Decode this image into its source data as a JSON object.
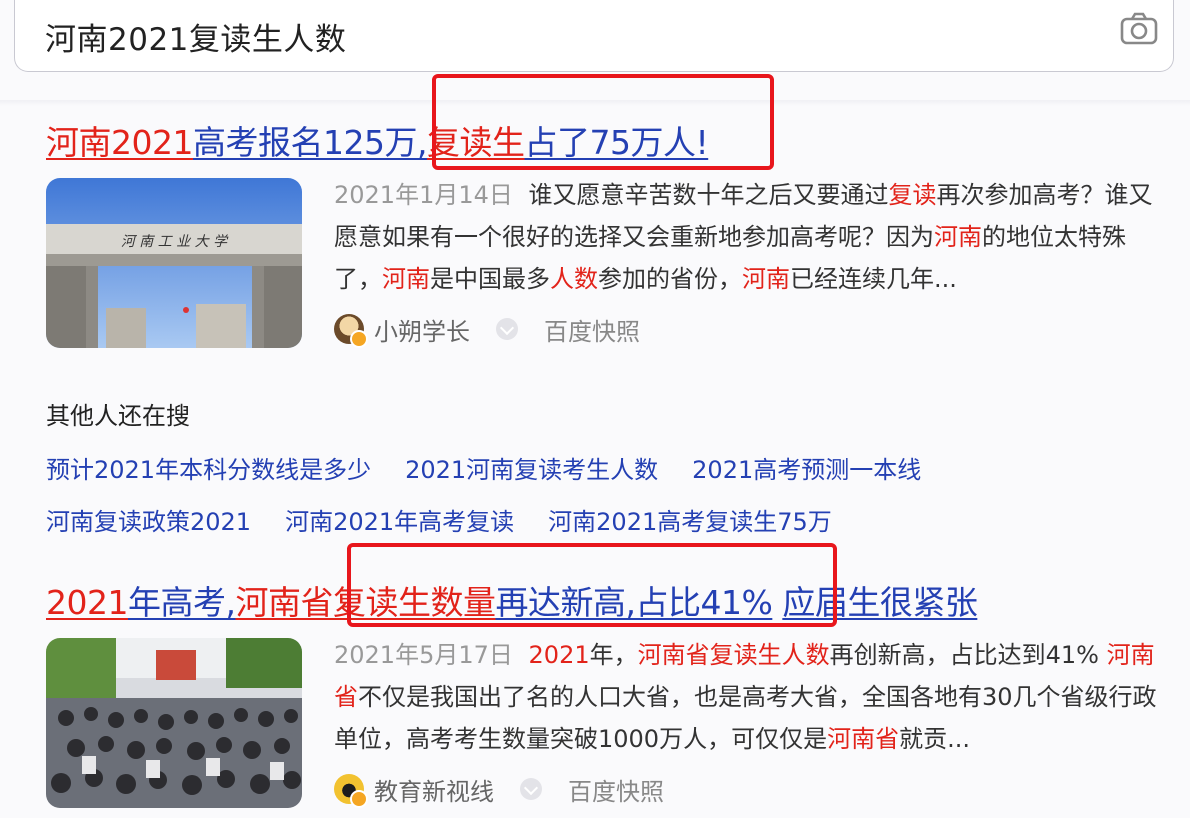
{
  "search": {
    "query": "河南2021复读生人数"
  },
  "results": [
    {
      "title_parts": [
        {
          "text": "河南2021",
          "style": "red"
        },
        {
          "text": "高考报名125万",
          "style": "blue"
        },
        {
          "text": ",",
          "style": "plain"
        },
        {
          "text": "复读生",
          "style": "red"
        },
        {
          "text": "占了75万人!",
          "style": "blue"
        }
      ],
      "date": "2021年1月14日",
      "abstract_parts": [
        {
          "text": "谁又愿意辛苦数十年之后又要通过",
          "em": false
        },
        {
          "text": "复读",
          "em": true
        },
        {
          "text": "再次参加高考？谁又愿意如果有一个很好的选择又会重新地参加高考呢？因为",
          "em": false
        },
        {
          "text": "河南",
          "em": true
        },
        {
          "text": "的地位太特殊了，",
          "em": false
        },
        {
          "text": "河南",
          "em": true
        },
        {
          "text": "是中国最多",
          "em": false
        },
        {
          "text": "人数",
          "em": true
        },
        {
          "text": "参加的省份，",
          "em": false
        },
        {
          "text": "河南",
          "em": true
        },
        {
          "text": "已经连续几年...",
          "em": false
        }
      ],
      "source_name": "小朔学长",
      "snapshot": "百度快照",
      "thumb_caption": "河 南 工 业 大 学"
    },
    {
      "title_parts": [
        {
          "text": "2021",
          "style": "red"
        },
        {
          "text": "年高考,",
          "style": "blue"
        },
        {
          "text": "河南省复读生数量",
          "style": "red"
        },
        {
          "text": "再达新高,占比41%",
          "style": "blue"
        },
        {
          "text": " ",
          "style": "plain"
        },
        {
          "text": "应届生很紧张",
          "style": "blue"
        }
      ],
      "date": "2021年5月17日",
      "abstract_parts": [
        {
          "text": "2021",
          "em": true
        },
        {
          "text": "年，",
          "em": false
        },
        {
          "text": "河南省复读生人数",
          "em": true
        },
        {
          "text": "再创新高，占比达到41% ",
          "em": false
        },
        {
          "text": "河南省",
          "em": true
        },
        {
          "text": "不仅是我国出了名的人口大省，也是高考大省，全国各地有30几个省级行政单位，高考考生数量突破1000万人，可仅仅是",
          "em": false
        },
        {
          "text": "河南省",
          "em": true
        },
        {
          "text": "就贡...",
          "em": false
        }
      ],
      "source_name": "教育新视线",
      "snapshot": "百度快照"
    }
  ],
  "related": {
    "heading": "其他人还在搜",
    "rows": [
      [
        "预计2021年本科分数线是多少",
        "2021河南复读考生人数",
        "2021高考预测一本线"
      ],
      [
        "河南复读政策2021",
        "河南2021年高考复读",
        "河南2021高考复读生75万"
      ]
    ]
  },
  "colors": {
    "link_blue": "#2440b3",
    "highlight_red": "#e2231a",
    "box_red": "#e8161c"
  }
}
